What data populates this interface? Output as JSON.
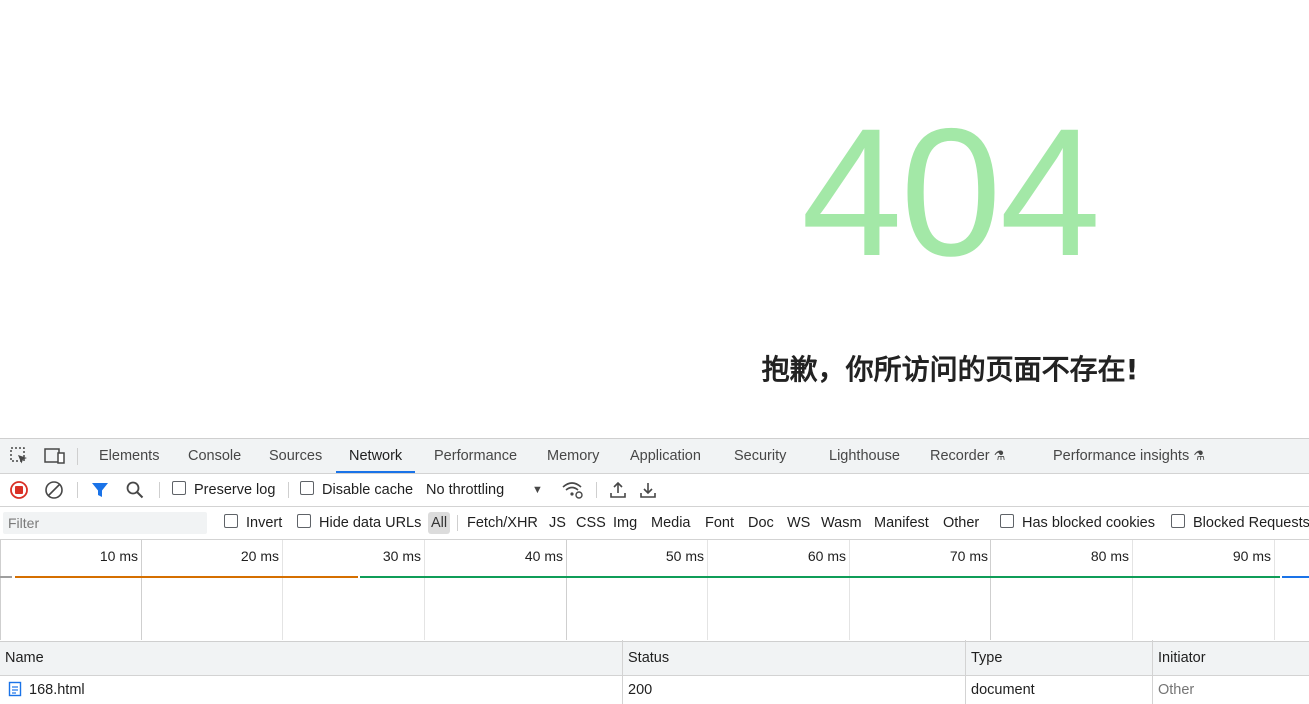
{
  "page": {
    "code": "404",
    "message": "抱歉，你所访问的页面不存在!"
  },
  "devtools": {
    "tabs": [
      "Elements",
      "Console",
      "Sources",
      "Network",
      "Performance",
      "Memory",
      "Application",
      "Security",
      "Lighthouse",
      "Recorder",
      "Performance insights"
    ],
    "active_tab": "Network",
    "toolbar": {
      "preserve_log": "Preserve log",
      "disable_cache": "Disable cache",
      "throttling": "No throttling"
    },
    "filter": {
      "placeholder": "Filter",
      "invert": "Invert",
      "hide_data_urls": "Hide data URLs",
      "types": [
        "All",
        "Fetch/XHR",
        "JS",
        "CSS",
        "Img",
        "Media",
        "Font",
        "Doc",
        "WS",
        "Wasm",
        "Manifest",
        "Other"
      ],
      "has_blocked_cookies": "Has blocked cookies",
      "blocked_requests": "Blocked Requests"
    },
    "timeline": {
      "ticks": [
        "10 ms",
        "20 ms",
        "30 ms",
        "40 ms",
        "50 ms",
        "60 ms",
        "70 ms",
        "80 ms",
        "90 ms"
      ],
      "colors": {
        "waiting": "#d56f00",
        "download": "#0f9d58",
        "other": "#1a73e8"
      }
    },
    "table": {
      "columns": [
        "Name",
        "Status",
        "Type",
        "Initiator"
      ],
      "rows": [
        {
          "name": "168.html",
          "status": "200",
          "type": "document",
          "initiator": "Other"
        }
      ]
    }
  }
}
